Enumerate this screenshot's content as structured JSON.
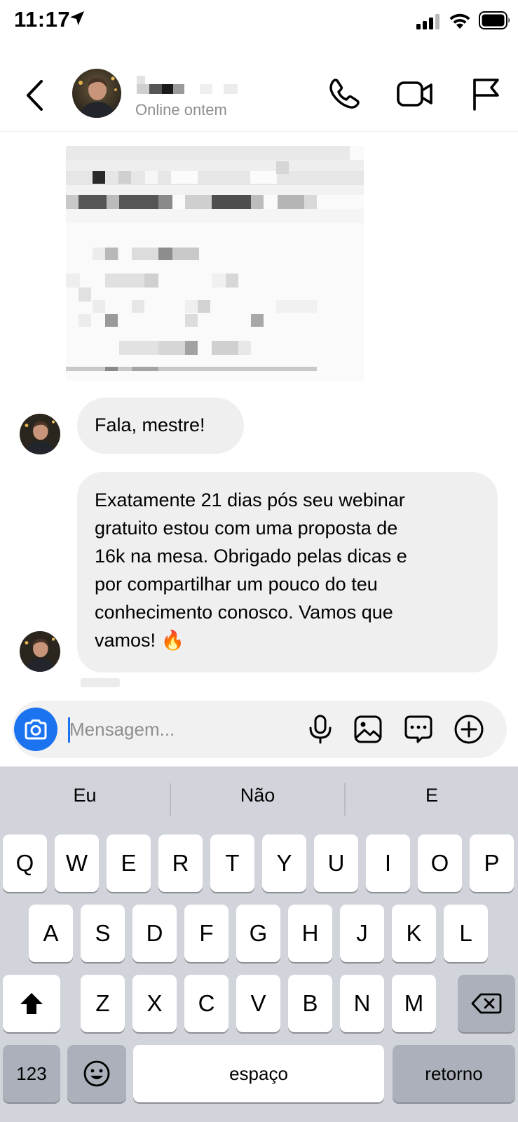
{
  "status_bar": {
    "time": "11:17",
    "icons": [
      "location-arrow-icon",
      "cellular-signal-icon",
      "wifi-icon",
      "battery-icon"
    ]
  },
  "header": {
    "back_icon": "chevron-left-icon",
    "contact_status": "Online ontem",
    "actions": [
      "phone-icon",
      "video-camera-icon",
      "flag-icon"
    ]
  },
  "messages": [
    {
      "text": "Fala, mestre!"
    },
    {
      "text": "Exatamente 21 dias pós seu webinar\ngratuito estou com uma proposta de\n16k na mesa. Obrigado pelas dicas e\npor compartilhar um pouco do teu\nconhecimento conosco. Vamos que\nvamos! 🔥"
    }
  ],
  "composer": {
    "placeholder": "Mensagem...",
    "icons": [
      "camera-icon",
      "microphone-icon",
      "image-icon",
      "sticker-icon",
      "plus-circle-icon"
    ],
    "accent_color": "#1c73f0"
  },
  "keyboard": {
    "suggestions": [
      "Eu",
      "Não",
      "E"
    ],
    "row1": [
      "Q",
      "W",
      "E",
      "R",
      "T",
      "Y",
      "U",
      "I",
      "O",
      "P"
    ],
    "row2": [
      "A",
      "S",
      "D",
      "F",
      "G",
      "H",
      "J",
      "K",
      "L"
    ],
    "row3": [
      "Z",
      "X",
      "C",
      "V",
      "B",
      "N",
      "M"
    ],
    "numbers_key": "123",
    "space_key": "espaço",
    "return_key": "retorno",
    "special_icons": [
      "shift-icon",
      "backspace-icon",
      "emoji-icon"
    ]
  }
}
